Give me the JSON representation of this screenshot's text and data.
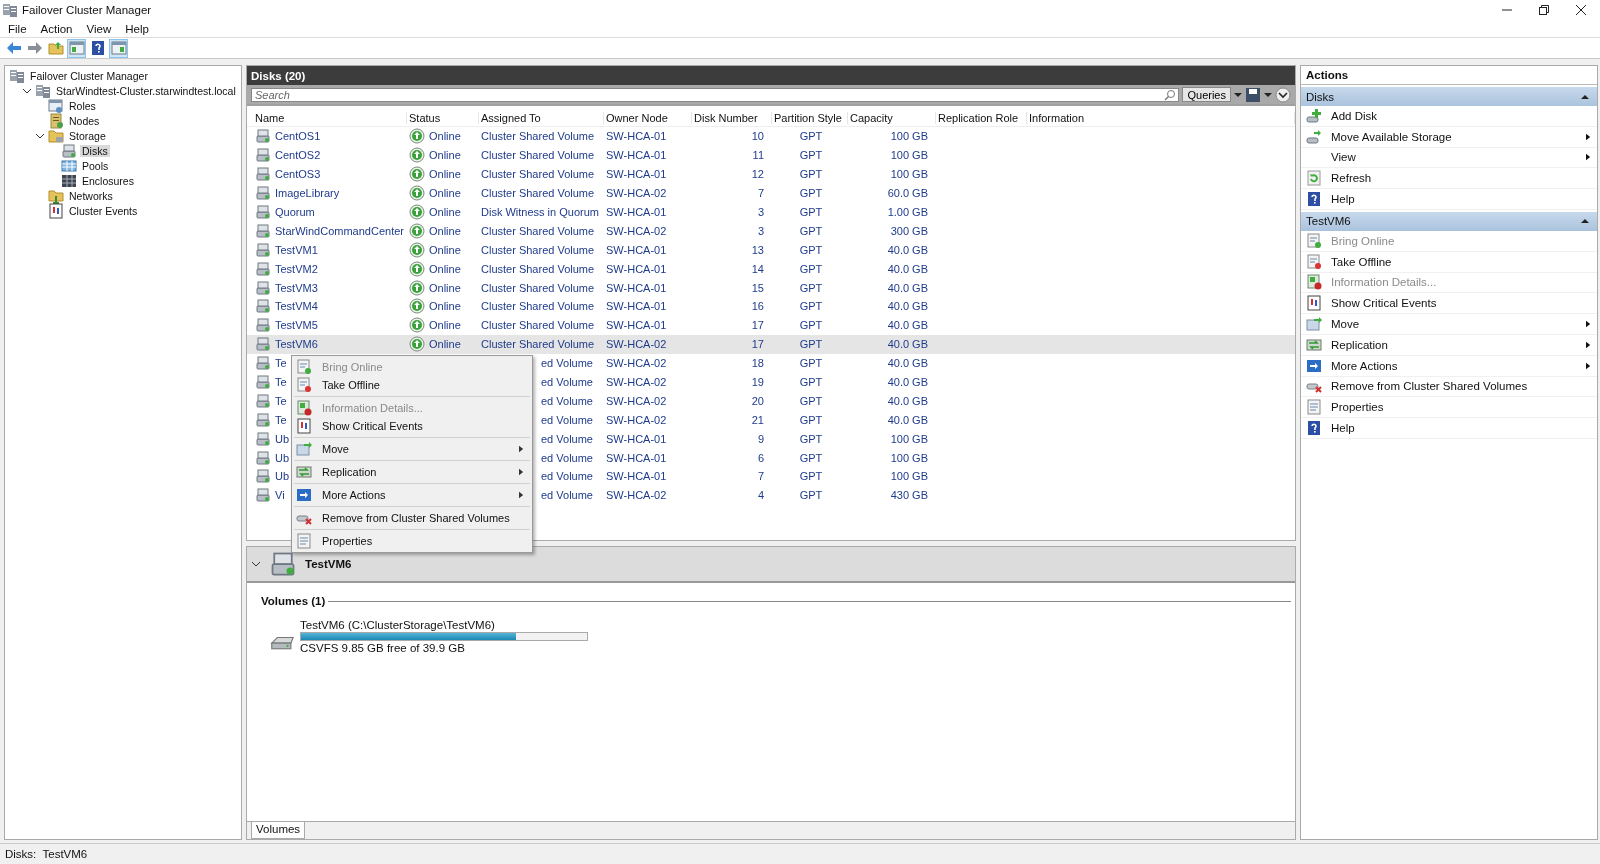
{
  "window": {
    "title": "Failover Cluster Manager"
  },
  "menu": [
    "File",
    "Action",
    "View",
    "Help"
  ],
  "toolbar": [
    {
      "on": false
    },
    {
      "on": false
    },
    {
      "on": false
    },
    {
      "on": true
    },
    {
      "on": false
    },
    {
      "on": true
    }
  ],
  "tree": [
    {
      "label": "Failover Cluster Manager",
      "selected": false,
      "children": [
        {
          "label": "StarWindtest-Cluster.starwindtest.local",
          "expanded": true,
          "selected": false,
          "children": [
            {
              "label": "Roles",
              "selected": false
            },
            {
              "label": "Nodes",
              "selected": false
            },
            {
              "label": "Storage",
              "expanded": true,
              "selected": false,
              "children": [
                {
                  "label": "Disks",
                  "selected": true
                },
                {
                  "label": "Pools",
                  "selected": false
                },
                {
                  "label": "Enclosures",
                  "selected": false
                }
              ]
            },
            {
              "label": "Networks",
              "selected": false
            },
            {
              "label": "Cluster Events",
              "selected": false
            }
          ]
        }
      ]
    }
  ],
  "center": {
    "title": "Disks (20)",
    "search": {
      "placeholder": "Search"
    },
    "queries": "Queries"
  },
  "table": {
    "columns": [
      "Name",
      "Status",
      "Assigned To",
      "Owner Node",
      "Disk Number",
      "Partition Style",
      "Capacity",
      "Replication Role",
      "Information"
    ],
    "rows": [
      {
        "name": "CentOS1",
        "status": "Online",
        "assigned": "Cluster Shared Volume",
        "owner": "SW-HCA-01",
        "disk": "10",
        "style": "GPT",
        "capacity": "100 GB",
        "selected": false
      },
      {
        "name": "CentOS2",
        "status": "Online",
        "assigned": "Cluster Shared Volume",
        "owner": "SW-HCA-01",
        "disk": "11",
        "style": "GPT",
        "capacity": "100 GB",
        "selected": false
      },
      {
        "name": "CentOS3",
        "status": "Online",
        "assigned": "Cluster Shared Volume",
        "owner": "SW-HCA-01",
        "disk": "12",
        "style": "GPT",
        "capacity": "100 GB",
        "selected": false
      },
      {
        "name": "ImageLibrary",
        "status": "Online",
        "assigned": "Cluster Shared Volume",
        "owner": "SW-HCA-02",
        "disk": "7",
        "style": "GPT",
        "capacity": "60.0 GB",
        "selected": false
      },
      {
        "name": "Quorum",
        "status": "Online",
        "assigned": "Disk Witness in Quorum",
        "owner": "SW-HCA-01",
        "disk": "3",
        "style": "GPT",
        "capacity": "1.00 GB",
        "selected": false
      },
      {
        "name": "StarWindCommandCenter",
        "status": "Online",
        "assigned": "Cluster Shared Volume",
        "owner": "SW-HCA-02",
        "disk": "3",
        "style": "GPT",
        "capacity": "300 GB",
        "selected": false
      },
      {
        "name": "TestVM1",
        "status": "Online",
        "assigned": "Cluster Shared Volume",
        "owner": "SW-HCA-01",
        "disk": "13",
        "style": "GPT",
        "capacity": "40.0 GB",
        "selected": false
      },
      {
        "name": "TestVM2",
        "status": "Online",
        "assigned": "Cluster Shared Volume",
        "owner": "SW-HCA-01",
        "disk": "14",
        "style": "GPT",
        "capacity": "40.0 GB",
        "selected": false
      },
      {
        "name": "TestVM3",
        "status": "Online",
        "assigned": "Cluster Shared Volume",
        "owner": "SW-HCA-01",
        "disk": "15",
        "style": "GPT",
        "capacity": "40.0 GB",
        "selected": false
      },
      {
        "name": "TestVM4",
        "status": "Online",
        "assigned": "Cluster Shared Volume",
        "owner": "SW-HCA-01",
        "disk": "16",
        "style": "GPT",
        "capacity": "40.0 GB",
        "selected": false
      },
      {
        "name": "TestVM5",
        "status": "Online",
        "assigned": "Cluster Shared Volume",
        "owner": "SW-HCA-01",
        "disk": "17",
        "style": "GPT",
        "capacity": "40.0 GB",
        "selected": false
      },
      {
        "name": "TestVM6",
        "status": "Online",
        "assigned": "Cluster Shared Volume",
        "owner": "SW-HCA-02",
        "disk": "17",
        "style": "GPT",
        "capacity": "40.0 GB",
        "selected": true
      },
      {
        "name": "Te",
        "assigned": "ed Volume",
        "owner": "SW-HCA-02",
        "disk": "18",
        "style": "GPT",
        "capacity": "40.0 GB",
        "selected": false
      },
      {
        "name": "Te",
        "assigned": "ed Volume",
        "owner": "SW-HCA-02",
        "disk": "19",
        "style": "GPT",
        "capacity": "40.0 GB",
        "selected": false
      },
      {
        "name": "Te",
        "assigned": "ed Volume",
        "owner": "SW-HCA-02",
        "disk": "20",
        "style": "GPT",
        "capacity": "40.0 GB",
        "selected": false
      },
      {
        "name": "Te",
        "assigned": "ed Volume",
        "owner": "SW-HCA-02",
        "disk": "21",
        "style": "GPT",
        "capacity": "40.0 GB",
        "selected": false
      },
      {
        "name": "Ub",
        "assigned": "ed Volume",
        "owner": "SW-HCA-01",
        "disk": "9",
        "style": "GPT",
        "capacity": "100 GB",
        "selected": false
      },
      {
        "name": "Ub",
        "assigned": "ed Volume",
        "owner": "SW-HCA-01",
        "disk": "6",
        "style": "GPT",
        "capacity": "100 GB",
        "selected": false
      },
      {
        "name": "Ub",
        "assigned": "ed Volume",
        "owner": "SW-HCA-01",
        "disk": "7",
        "style": "GPT",
        "capacity": "100 GB",
        "selected": false
      },
      {
        "name": "Vi",
        "assigned": "ed Volume",
        "owner": "SW-HCA-02",
        "disk": "4",
        "style": "GPT",
        "capacity": "430 GB",
        "selected": false
      }
    ]
  },
  "context_menu": {
    "groups": [
      [
        {
          "label": "Bring Online",
          "disabled": true,
          "submenu": false
        },
        {
          "label": "Take Offline",
          "disabled": false,
          "submenu": false
        }
      ],
      [
        {
          "label": "Information Details...",
          "disabled": true,
          "submenu": false
        },
        {
          "label": "Show Critical Events",
          "disabled": false,
          "submenu": false
        }
      ],
      [
        {
          "label": "Move",
          "disabled": false,
          "submenu": true
        }
      ],
      [
        {
          "label": "Replication",
          "disabled": false,
          "submenu": true
        }
      ],
      [
        {
          "label": "More Actions",
          "disabled": false,
          "submenu": true
        }
      ],
      [
        {
          "label": "Remove from Cluster Shared Volumes",
          "disabled": false,
          "submenu": false
        }
      ],
      [
        {
          "label": "Properties",
          "disabled": false,
          "submenu": false
        }
      ]
    ]
  },
  "detail": {
    "title": "TestVM6",
    "expanded": true,
    "section": "Volumes (1)",
    "volumes": [
      {
        "label": "TestVM6 (C:\\ClusterStorage\\TestVM6)",
        "level": 0.75,
        "info": "CSVFS 9.85 GB free of 39.9 GB"
      }
    ],
    "tabs": [
      {
        "label": "Volumes",
        "selected": true
      }
    ]
  },
  "actions": {
    "title": "Actions",
    "sections": [
      {
        "title": "Disks",
        "expanded": true,
        "items": [
          {
            "label": "Add Disk",
            "disabled": false,
            "submenu": false
          },
          {
            "label": "Move Available Storage",
            "disabled": false,
            "submenu": true
          },
          {
            "label": "View",
            "disabled": false,
            "submenu": true
          },
          {
            "label": "Refresh",
            "disabled": false,
            "submenu": false
          },
          {
            "label": "Help",
            "disabled": false,
            "submenu": false
          }
        ]
      },
      {
        "title": "TestVM6",
        "expanded": true,
        "items": [
          {
            "label": "Bring Online",
            "disabled": true,
            "submenu": false
          },
          {
            "label": "Take Offline",
            "disabled": false,
            "submenu": false
          },
          {
            "label": "Information Details...",
            "disabled": true,
            "submenu": false
          },
          {
            "label": "Show Critical Events",
            "disabled": false,
            "submenu": false
          },
          {
            "label": "Move",
            "disabled": false,
            "submenu": true
          },
          {
            "label": "Replication",
            "disabled": false,
            "submenu": true
          },
          {
            "label": "More Actions",
            "disabled": false,
            "submenu": true
          },
          {
            "label": "Remove from Cluster Shared Volumes",
            "disabled": false,
            "submenu": false
          },
          {
            "label": "Properties",
            "disabled": false,
            "submenu": false
          },
          {
            "label": "Help",
            "disabled": false,
            "submenu": false
          }
        ]
      }
    ]
  },
  "status_bar": "Disks:  TestVM6"
}
